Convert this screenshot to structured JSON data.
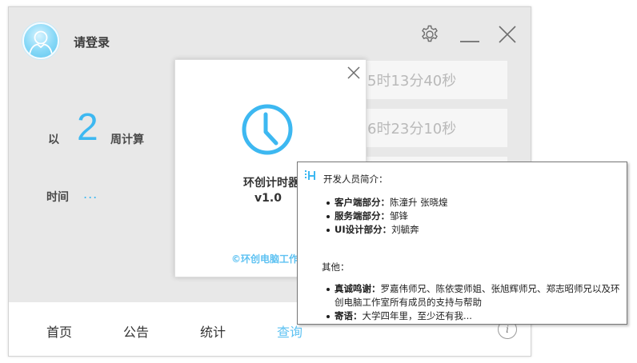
{
  "header": {
    "login_label": "请登录",
    "icons": [
      "avatar-user-icon",
      "gear-icon",
      "minimize-icon",
      "close-icon"
    ]
  },
  "period": {
    "prefix": "以",
    "weeks": "2",
    "suffix": "周计算",
    "time_label": "时间",
    "time_value": "..."
  },
  "time_boxes": [
    "5时13分40秒",
    "6时23分10秒"
  ],
  "nav": {
    "tabs": [
      {
        "label": "首页",
        "active": false
      },
      {
        "label": "公告",
        "active": false
      },
      {
        "label": "统计",
        "active": false
      },
      {
        "label": "查询",
        "active": true
      }
    ],
    "info_label": "i"
  },
  "about": {
    "app_name": "环创计时器",
    "version": "v1.0",
    "studio_link": "©环创电脑工作"
  },
  "tooltip": {
    "heading": "开发人员简介：",
    "developers": [
      {
        "key": "客户端部分：",
        "value": "陈潼升 张晓煌"
      },
      {
        "key": "服务端部分：",
        "value": "邹锋"
      },
      {
        "key": "UI设计部分：",
        "value": "刘毓奔"
      }
    ],
    "other_label": "其他：",
    "others": [
      {
        "key": "真诚鸣谢：",
        "value": "罗嘉伟师兄、陈依雯师姐、张旭辉师兄、郑志昭师兄以及环创电脑工作室所有成员的支持与帮助"
      },
      {
        "key": "寄语：",
        "value": "大学四年里，至少还有我..."
      }
    ]
  },
  "colors": {
    "accent": "#3db8f1",
    "window_bg": "#e8e8e8",
    "tab_active": "#5ec2f2"
  }
}
